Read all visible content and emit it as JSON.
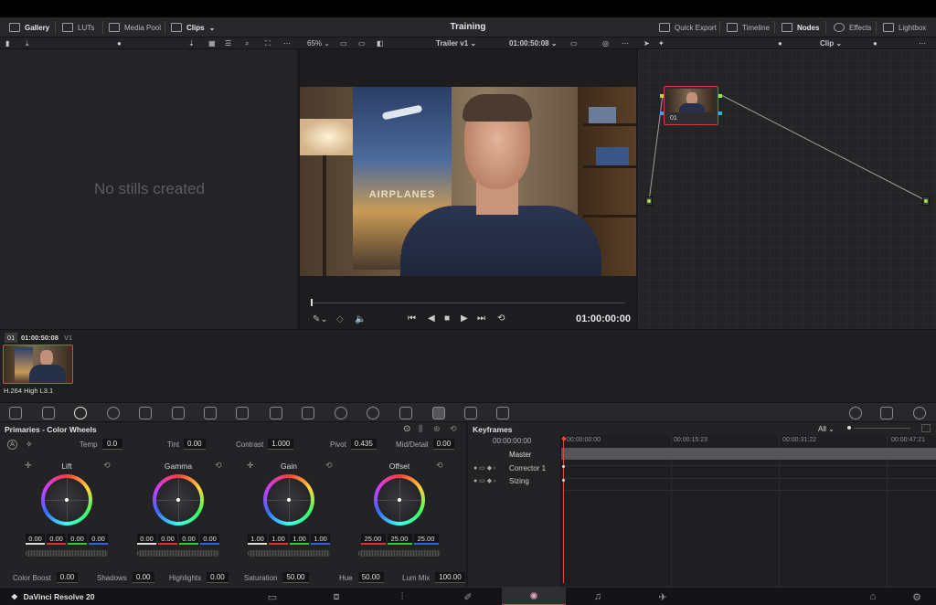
{
  "header": {
    "left": [
      {
        "label": "Gallery",
        "active": true
      },
      {
        "label": "LUTs"
      },
      {
        "label": "Media Pool"
      },
      {
        "label": "Clips",
        "dropdown": true,
        "active": true
      }
    ],
    "title": "Training",
    "right": [
      {
        "label": "Quick Export"
      },
      {
        "label": "Timeline"
      },
      {
        "label": "Nodes",
        "active": true
      },
      {
        "label": "Effects"
      },
      {
        "label": "Lightbox"
      }
    ]
  },
  "toolbar": {
    "zoom": "65%",
    "timeline": "Trailer v1",
    "timecode": "01:00:50:08",
    "mode": "Clip"
  },
  "gallery": {
    "empty_text": "No stills created"
  },
  "viewer": {
    "poster_text": "AIRPLANES",
    "current_time": "01:00:00:00"
  },
  "node": {
    "label": "01"
  },
  "strip": {
    "clip_index": "01",
    "clip_timecode": "01:00:50:08",
    "track": "V1",
    "codec": "H.264 High L3.1"
  },
  "primaries": {
    "title": "Primaries - Color Wheels",
    "params": [
      {
        "label": "Temp",
        "value": "0.0"
      },
      {
        "label": "Tint",
        "value": "0.00"
      },
      {
        "label": "Contrast",
        "value": "1.000"
      },
      {
        "label": "Pivot",
        "value": "0.435"
      },
      {
        "label": "Mid/Detail",
        "value": "0.00"
      }
    ],
    "wheels": [
      {
        "name": "Lift",
        "values": [
          "0.00",
          "0.00",
          "0.00",
          "0.00"
        ]
      },
      {
        "name": "Gamma",
        "values": [
          "0.00",
          "0.00",
          "0.00",
          "0.00"
        ]
      },
      {
        "name": "Gain",
        "values": [
          "1.00",
          "1.00",
          "1.00",
          "1.00"
        ]
      },
      {
        "name": "Offset",
        "values": [
          "25.00",
          "25.00",
          "25.00"
        ]
      }
    ],
    "bottom_params": [
      {
        "label": "Color Boost",
        "value": "0.00"
      },
      {
        "label": "Shadows",
        "value": "0.00"
      },
      {
        "label": "Highlights",
        "value": "0.00"
      },
      {
        "label": "Saturation",
        "value": "50.00"
      },
      {
        "label": "Hue",
        "value": "50.00"
      },
      {
        "label": "Lum Mix",
        "value": "100.00"
      }
    ]
  },
  "keyframes": {
    "title": "Keyframes",
    "filter": "All",
    "timecode": "00:00:00:00",
    "ticks": [
      "00:00:00:00",
      "00:00:15:23",
      "00:00:31:22",
      "00:00:47:21"
    ],
    "tracks": [
      "Master",
      "Corrector 1",
      "Sizing"
    ]
  },
  "bottombar": {
    "app_name": "DaVinci Resolve 20"
  },
  "colors": {
    "accent": "#e64a3c",
    "active_node_border": "#d04040",
    "playhead": "#e8442f"
  }
}
